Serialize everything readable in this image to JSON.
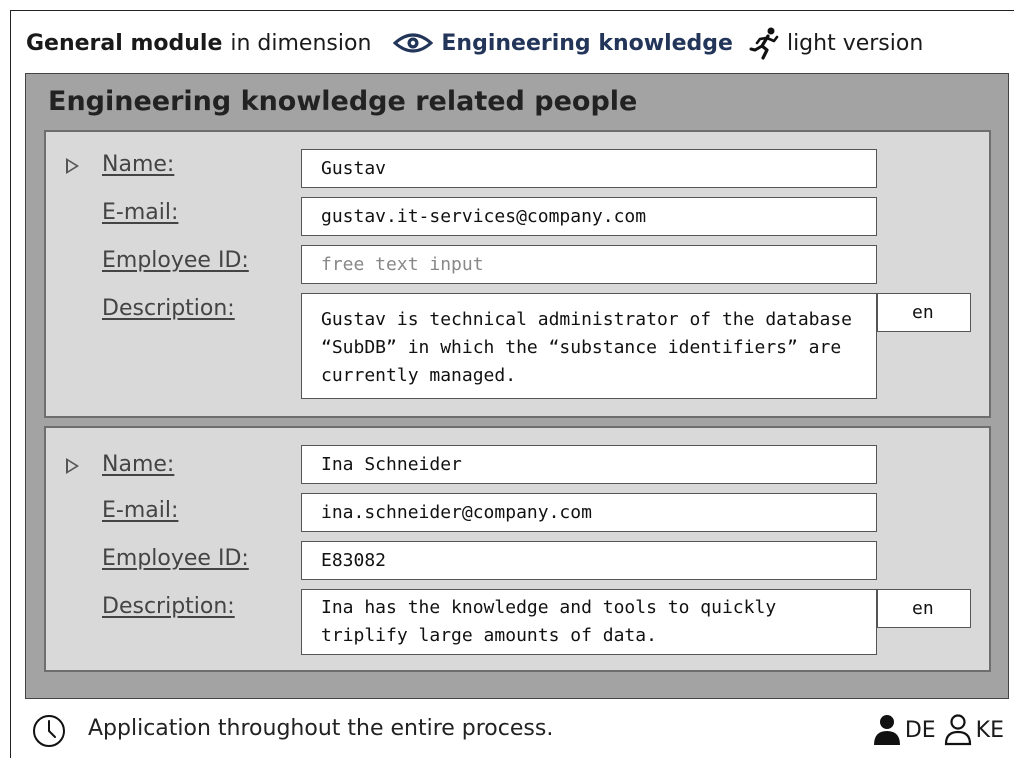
{
  "header": {
    "module_label": "General module",
    "in_dimension": "in dimension",
    "dimension_name": "Engineering knowledge",
    "version_label": "light version",
    "dimension_icon": "eye-icon",
    "version_icon": "runner-icon",
    "accent_color": "#23365a"
  },
  "panel": {
    "title": "Engineering knowledge related people"
  },
  "people": [
    {
      "name_label": "Name:",
      "email_label": "E-mail:",
      "employee_id_label": "Employee ID:",
      "description_label": "Description:",
      "name": "Gustav",
      "email": "gustav.it-services@company.com",
      "employee_id_placeholder": "free text input",
      "description": "Gustav is technical administrator of the database “SubDB” in which the “substance identifiers” are currently managed.",
      "language": "en"
    },
    {
      "name_label": "Name:",
      "email_label": "E-mail:",
      "employee_id_label": "Employee ID:",
      "description_label": "Description:",
      "name": "Ina Schneider",
      "email": "ina.schneider@company.com",
      "employee_id": "E83082",
      "description": "Ina has the knowledge and tools to quickly triplify large amounts of data.",
      "language": "en"
    }
  ],
  "footer": {
    "text": "Application throughout the entire process.",
    "icon": "clock-icon",
    "roles": [
      {
        "code": "DE",
        "icon": "person-filled-icon"
      },
      {
        "code": "KE",
        "icon": "person-outline-icon"
      }
    ]
  }
}
